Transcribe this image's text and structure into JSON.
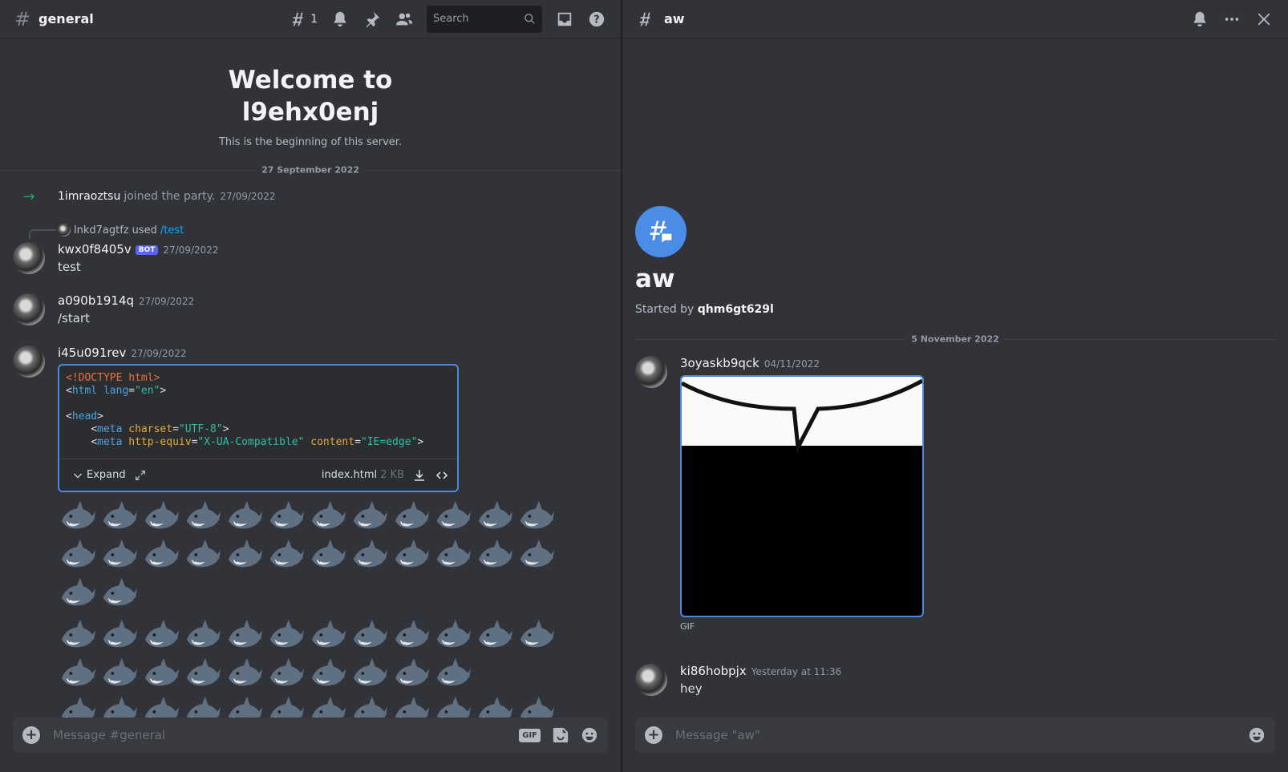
{
  "left": {
    "channel_name": "general",
    "hash_symbol": "#",
    "thread_count": "1",
    "search_placeholder": "Search",
    "welcome_title": "Welcome to l9ehx0enj",
    "welcome_subtitle": "This is the beginning of this server.",
    "date_divider": "27 September 2022",
    "join": {
      "user": "1imraoztsu",
      "text": "joined the party.",
      "timestamp": "27/09/2022"
    },
    "reply": {
      "user": "lnkd7agtfz",
      "used": "used",
      "command": "/test"
    },
    "messages": [
      {
        "author": "kwx0f8405v",
        "badge": "BOT",
        "timestamp": "27/09/2022",
        "text": "test"
      },
      {
        "author": "a090b1914q",
        "timestamp": "27/09/2022",
        "text": "/start"
      },
      {
        "author": "i45u091rev",
        "timestamp": "27/09/2022"
      }
    ],
    "code": {
      "expand_label": "Expand",
      "filename": "index.html",
      "filesize": "2 KB"
    },
    "composer_placeholder": "Message #general",
    "gif_label": "GIF",
    "shark_emoji_name": "shark-emoji"
  },
  "right": {
    "channel_name": "aw",
    "thread_title": "aw",
    "started_by_label": "Started by",
    "started_by_user": "qhm6gt629l",
    "date_divider": "5 November 2022",
    "messages": [
      {
        "author": "3oyaskb9qck",
        "timestamp": "04/11/2022",
        "attachment_label": "GIF"
      },
      {
        "author": "ki86hobpjx",
        "timestamp": "Yesterday at 11:36",
        "text": "hey"
      }
    ],
    "composer_placeholder": "Message \"aw\""
  },
  "colors": {
    "background": "#313338",
    "accent_blue": "#4b89e0",
    "join_green": "#23a55a",
    "bot_badge": "#5865f2",
    "command_link": "#00a8fc"
  }
}
